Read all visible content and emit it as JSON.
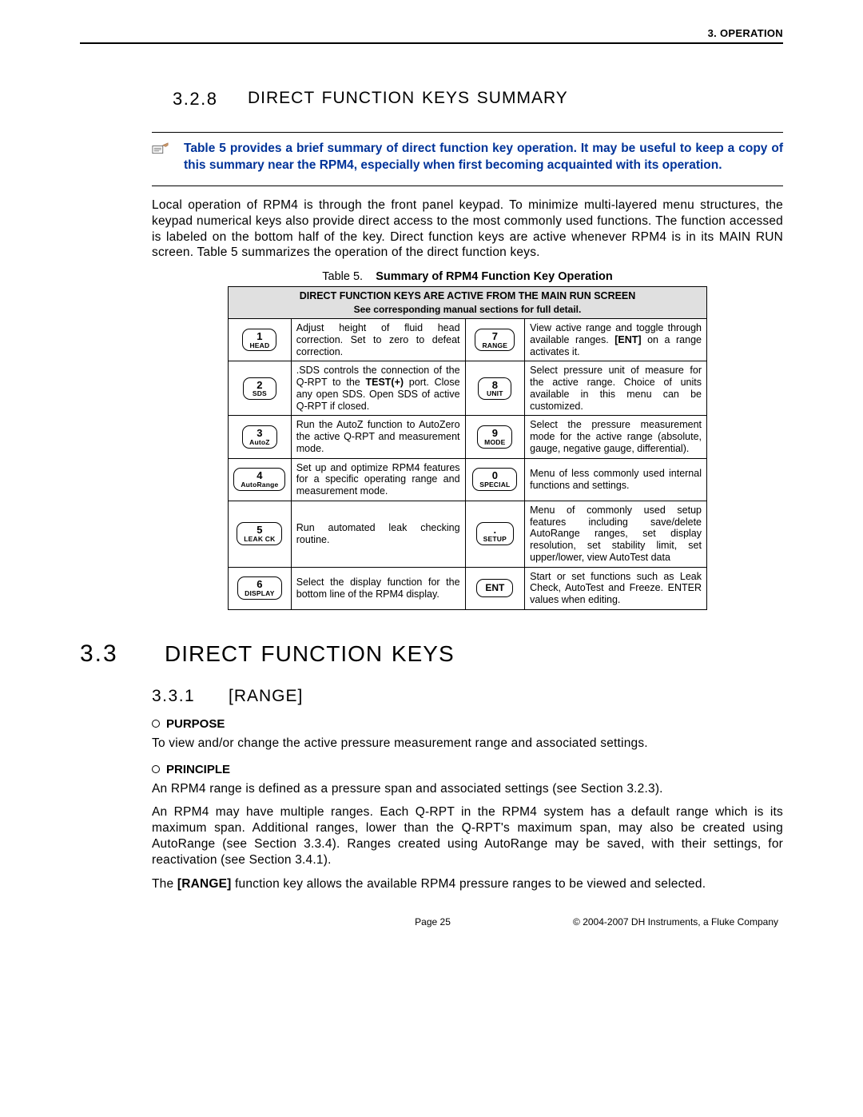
{
  "header": {
    "right": "3.  OPERATION"
  },
  "section_328": {
    "num": "3.2.8",
    "title": "DIRECT FUNCTION KEYS SUMMARY"
  },
  "note_328": "Table 5 provides a brief summary of direct function key operation.  It may be useful to keep a copy of this summary near the RPM4, especially when first becoming acquainted with its operation.",
  "para_328": "Local operation of RPM4 is through the front panel keypad.  To minimize multi-layered menu structures, the keypad numerical keys also provide direct access to the most commonly used functions.  The function accessed is labeled on the bottom half of the key.  Direct function keys are active whenever RPM4 is in its MAIN RUN screen.  Table 5 summarizes the operation of the direct function keys.",
  "table": {
    "caption_label": "Table 5.",
    "caption_title": "Summary of RPM4 Function Key Operation",
    "header_line1": "DIRECT FUNCTION KEYS ARE ACTIVE FROM THE MAIN RUN SCREEN",
    "header_line2": "See corresponding manual sections for full detail.",
    "rows": [
      {
        "left_key_top": "1",
        "left_key_bot": "HEAD",
        "left_desc": "Adjust height of fluid head correction. Set to zero to defeat correction.",
        "right_key_top": "7",
        "right_key_bot": "RANGE",
        "right_desc_pre": "View active range and toggle through available ranges.  ",
        "right_desc_bold": "[ENT]",
        "right_desc_post": " on a range activates it."
      },
      {
        "left_key_top": "2",
        "left_key_bot": "SDS",
        "left_desc_pre": ".SDS controls the connection of the Q-RPT to the ",
        "left_desc_bold": "TEST(+)",
        "left_desc_post": " port. Close any open SDS.  Open SDS of active Q-RPT if closed.",
        "right_key_top": "8",
        "right_key_bot": "UNIT",
        "right_desc": "Select pressure unit of measure for the active range.  Choice of units available in this menu can be customized."
      },
      {
        "left_key_top": "3",
        "left_key_bot": "AutoZ",
        "left_desc": "Run the AutoZ function to AutoZero the active Q-RPT and measurement mode.",
        "right_key_top": "9",
        "right_key_bot": "MODE",
        "right_desc": "Select the pressure measurement mode for the active range (absolute, gauge, negative gauge, differential)."
      },
      {
        "left_key_top": "4",
        "left_key_bot": "AutoRange",
        "left_desc": "Set up and optimize RPM4 features for a specific operating range and measurement mode.",
        "right_key_top": "0",
        "right_key_bot": "SPECIAL",
        "right_desc": "Menu of less commonly used internal functions and settings."
      },
      {
        "left_key_top": "5",
        "left_key_bot": "LEAK CK",
        "left_desc": "Run automated leak checking routine.",
        "right_key_top": ".",
        "right_key_bot": "SETUP",
        "right_desc": "Menu of commonly used setup features including save/delete AutoRange ranges, set display resolution, set stability limit, set upper/lower, view AutoTest data"
      },
      {
        "left_key_top": "6",
        "left_key_bot": "DISPLAY",
        "left_desc": "Select the display function for the bottom line of the RPM4 display.",
        "right_key_top": "ENT",
        "right_key_bot": "",
        "right_desc": "Start or set functions such as Leak Check, AutoTest and Freeze. ENTER values when editing."
      }
    ]
  },
  "section_33": {
    "num": "3.3",
    "title": "DIRECT FUNCTION KEYS"
  },
  "section_331": {
    "num": "3.3.1",
    "title": "[RANGE]"
  },
  "purpose": {
    "label": "PURPOSE",
    "text": "To view and/or change the active pressure measurement range and associated settings."
  },
  "principle": {
    "label": "PRINCIPLE",
    "p1": "An RPM4 range is defined as a pressure span and associated settings (see Section 3.2.3).",
    "p2": "An RPM4 may have multiple ranges.  Each Q-RPT in the RPM4 system has a default range which is its maximum span.  Additional ranges, lower than the Q-RPT's maximum span, may also be created using AutoRange (see Section 3.3.4).  Ranges created using AutoRange may be saved, with their settings, for reactivation (see Section 3.4.1).",
    "p3_pre": "The ",
    "p3_bold": "[RANGE]",
    "p3_post": " function key allows the available RPM4 pressure ranges to be viewed and selected."
  },
  "footer": {
    "page": "Page 25",
    "copyright": "© 2004-2007 DH Instruments, a Fluke Company"
  }
}
